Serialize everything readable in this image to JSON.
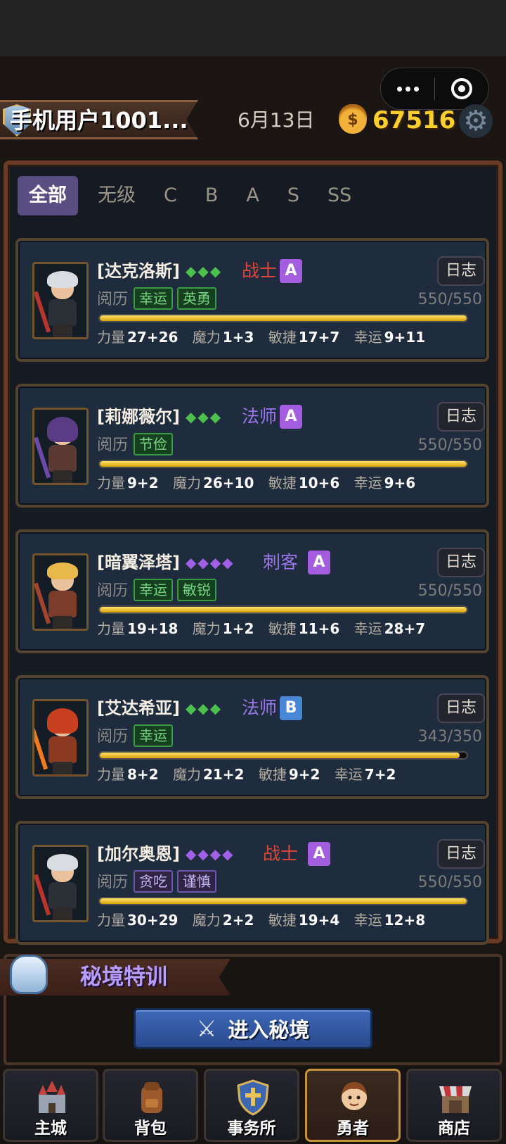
{
  "header": {
    "user_name": "手机用户1001...",
    "date": "6月13日",
    "gold": "67516"
  },
  "filters": [
    "全部",
    "无级",
    "C",
    "B",
    "A",
    "S",
    "SS"
  ],
  "exp_label": "阅历",
  "log_label": "日志",
  "stat_labels": {
    "str": "力量",
    "mag": "魔力",
    "agi": "敏捷",
    "luck": "幸运"
  },
  "heroes": [
    {
      "name": "[达克洛斯]",
      "stars": "◆◆◆",
      "star_color": "#4cbf4f",
      "class": "战士",
      "class_color": "#e0443a",
      "rank": "A",
      "rank_color": "#a35ee0",
      "traits": [
        {
          "label": "幸运",
          "kind": "good"
        },
        {
          "label": "英勇",
          "kind": "good"
        }
      ],
      "exp": "550/550",
      "exp_ratio": 1.0,
      "stats": {
        "str": "27+26",
        "mag": "1+3",
        "agi": "17+7",
        "luck": "9+11"
      }
    },
    {
      "name": "[莉娜薇尔]",
      "stars": "◆◆◆",
      "star_color": "#4cbf4f",
      "class": "法师",
      "class_color": "#9b78ea",
      "rank": "A",
      "rank_color": "#a35ee0",
      "traits": [
        {
          "label": "节俭",
          "kind": "good"
        }
      ],
      "exp": "550/550",
      "exp_ratio": 1.0,
      "stats": {
        "str": "9+2",
        "mag": "26+10",
        "agi": "10+6",
        "luck": "9+6"
      }
    },
    {
      "name": "[暗翼泽塔]",
      "stars": "◆◆◆◆",
      "star_color": "#a061e8",
      "class": "刺客",
      "class_color": "#9b78ea",
      "rank": "A",
      "rank_color": "#a35ee0",
      "traits": [
        {
          "label": "幸运",
          "kind": "good"
        },
        {
          "label": "敏锐",
          "kind": "good"
        }
      ],
      "exp": "550/550",
      "exp_ratio": 1.0,
      "stats": {
        "str": "19+18",
        "mag": "1+2",
        "agi": "11+6",
        "luck": "28+7"
      }
    },
    {
      "name": "[艾达希亚]",
      "stars": "◆◆◆",
      "star_color": "#4cbf4f",
      "class": "法师",
      "class_color": "#9b78ea",
      "rank": "B",
      "rank_color": "#4a86d6",
      "traits": [
        {
          "label": "幸运",
          "kind": "good"
        }
      ],
      "exp": "343/350",
      "exp_ratio": 0.98,
      "stats": {
        "str": "8+2",
        "mag": "21+2",
        "agi": "9+2",
        "luck": "7+2"
      }
    },
    {
      "name": "[加尔奥恩]",
      "stars": "◆◆◆◆",
      "star_color": "#a061e8",
      "class": "战士",
      "class_color": "#e0443a",
      "rank": "A",
      "rank_color": "#a35ee0",
      "traits": [
        {
          "label": "贪吃",
          "kind": "bad"
        },
        {
          "label": "谨慎",
          "kind": "bad"
        }
      ],
      "exp": "550/550",
      "exp_ratio": 1.0,
      "stats": {
        "str": "30+29",
        "mag": "2+2",
        "agi": "19+4",
        "luck": "12+8"
      }
    }
  ],
  "dungeon": {
    "title": "秘境特训",
    "button": "进入秘境"
  },
  "nav": [
    "主城",
    "背包",
    "事务所",
    "勇者",
    "商店"
  ],
  "colors": {
    "gold": "#ffcf2f",
    "accent_purple": "#5a4d82",
    "exp_bar": "#ffd43b"
  }
}
